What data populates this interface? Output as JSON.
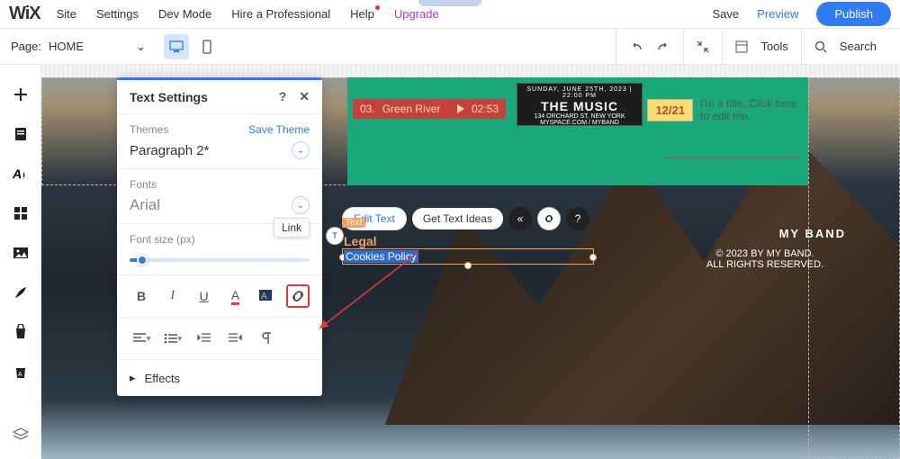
{
  "topbar": {
    "logo": "WiX",
    "menu": [
      "Site",
      "Settings",
      "Dev Mode",
      "Hire a Professional",
      "Help",
      "Upgrade"
    ],
    "save": "Save",
    "preview": "Preview",
    "publish": "Publish"
  },
  "secondbar": {
    "page_prefix": "Page:",
    "page_name": "HOME",
    "undo_icon": "undo",
    "redo_icon": "redo",
    "collapse_icon": "collapse",
    "tools": "Tools",
    "search": "Search"
  },
  "left_icons": [
    "plus",
    "page",
    "text-style",
    "apps",
    "image",
    "pen",
    "store",
    "store-badge",
    "layers"
  ],
  "canvas": {
    "track": {
      "num": "03.",
      "name": "Green River",
      "time": "02:53"
    },
    "card": {
      "line1": "SUNDAY, JUNE 25TH, 2023 | 22:00 PM",
      "title": "THE MUSIC",
      "addr": "134 ORCHARD ST.   NEW YORK",
      "site": "MYSPACE.COM / MYBAND"
    },
    "date_badge": "12/21",
    "edit_title": "I'm a title, Click here to edit me.",
    "legal": "Legal",
    "text_tag": "Text",
    "cookies": "Cookies Policy",
    "band": "MY BAND",
    "copyright1": "© 2023 BY MY BAND.",
    "copyright2": "ALL RIGHTS RESERVED.",
    "toolbar": {
      "edit": "Edit Text",
      "ideas": "Get Text Ideas"
    }
  },
  "panel": {
    "title": "Text Settings",
    "themes_label": "Themes",
    "save_theme": "Save Theme",
    "theme_value": "Paragraph 2*",
    "fonts_label": "Fonts",
    "font_value": "Arial",
    "size_label": "Font size (px)",
    "link_tooltip": "Link",
    "effects": "Effects"
  }
}
